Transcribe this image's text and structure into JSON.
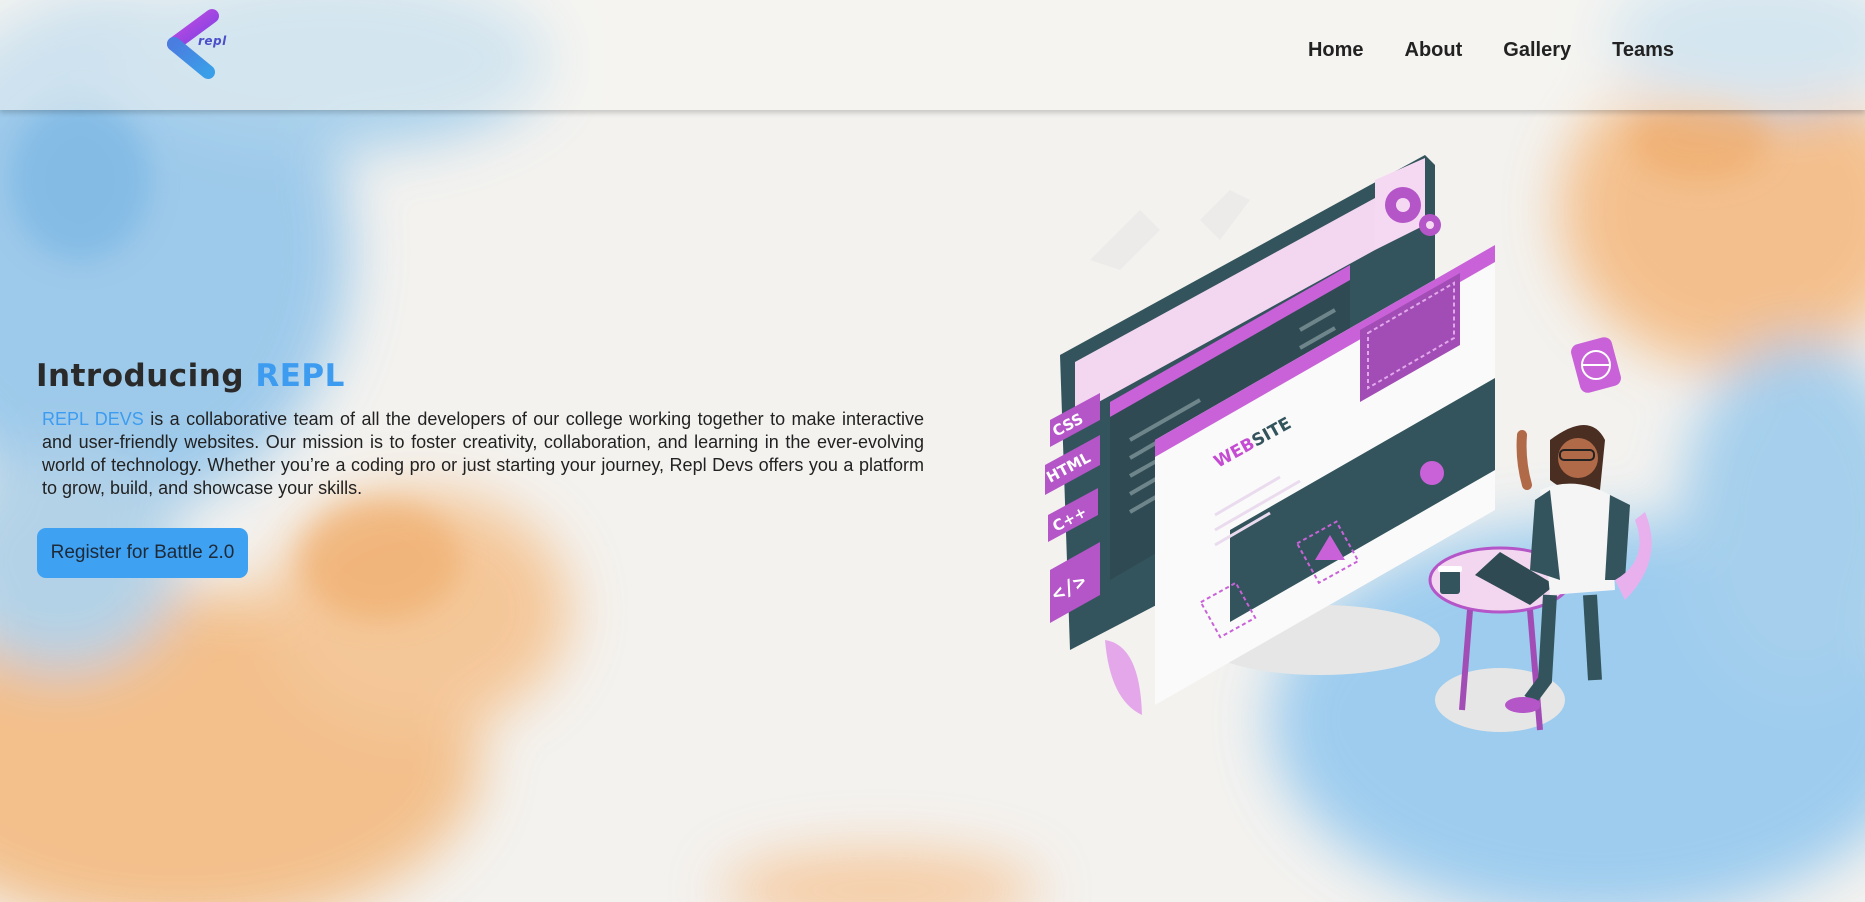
{
  "brand": {
    "logo_text": "repl"
  },
  "nav": {
    "items": [
      "Home",
      "About",
      "Gallery",
      "Teams"
    ]
  },
  "hero": {
    "title_prefix": "Introducing",
    "title_accent": "REPL",
    "paragraph_accent": "REPL DEVS",
    "paragraph_rest": "is a collaborative team of all the developers of our college working together to make interactive and user-friendly websites. Our mission is to foster creativity, collaboration, and learning in the ever-evolving world of technology. Whether you’re a coding pro or just starting your journey, Repl Devs offers you a platform to grow, build, and showcase your skills.",
    "cta_label": "Register for Battle 2.0"
  },
  "illustration": {
    "tags": [
      "CSS",
      "HTML",
      "C++"
    ],
    "website_label_accent": "WEB",
    "website_label_rest": "SITE"
  },
  "colors": {
    "accent_blue": "#3d9cf0",
    "button_blue": "#3ea1f2",
    "illustration_purple": "#b455c8",
    "illustration_dark": "#33545c"
  }
}
